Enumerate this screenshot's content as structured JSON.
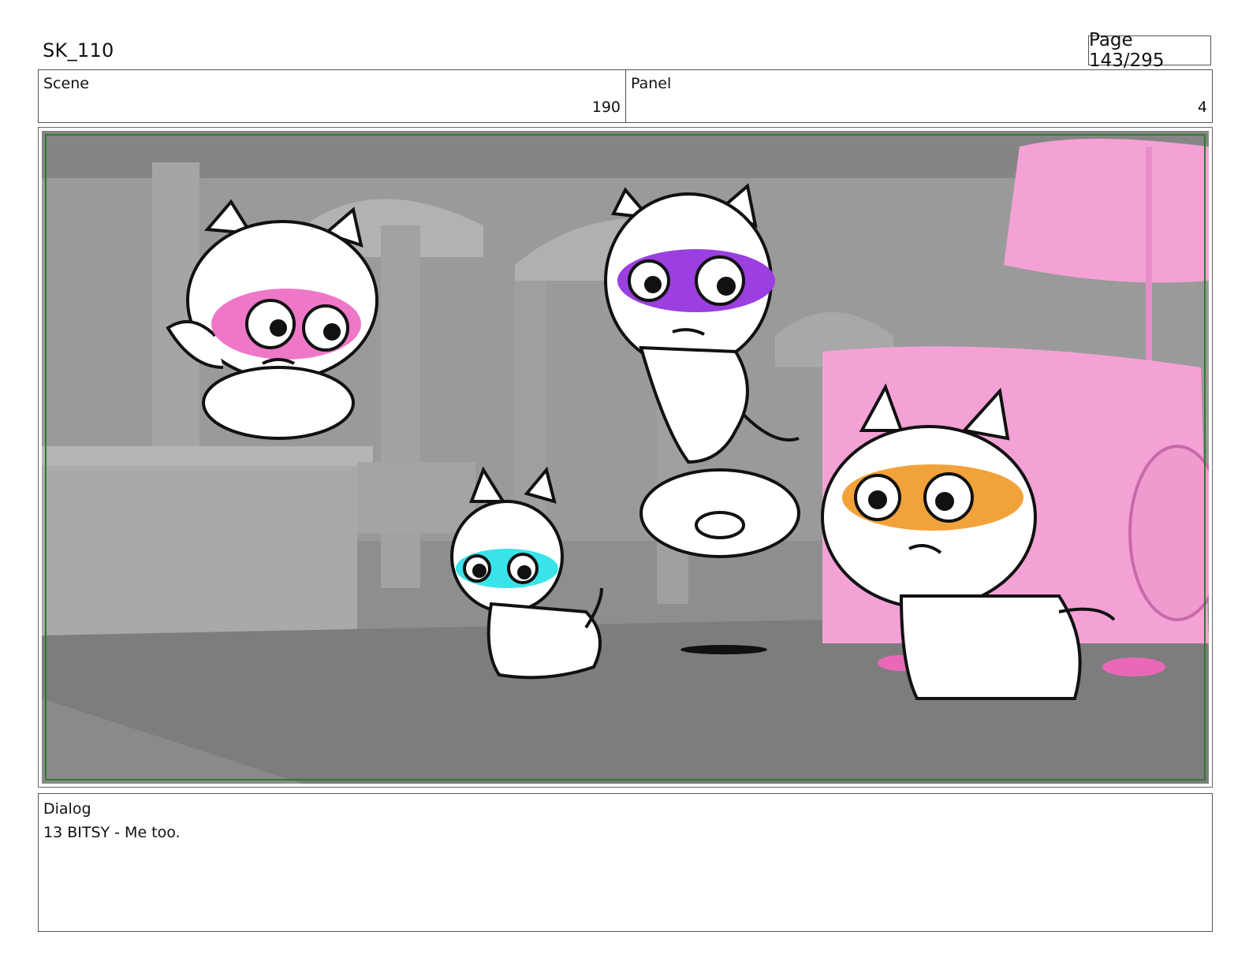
{
  "header": {
    "title": "SK_110",
    "page_label": "Page 143/295"
  },
  "info": {
    "scene_label": "Scene",
    "scene_value": "190",
    "panel_label": "Panel",
    "panel_value": "4"
  },
  "frame": {
    "characters": [
      {
        "id": "cat-pink-mask",
        "mask_color": "#ee77c8"
      },
      {
        "id": "cat-purple-mask",
        "mask_color": "#9b3fe0"
      },
      {
        "id": "cat-cyan-mask",
        "mask_color": "#39e3ea"
      },
      {
        "id": "cat-orange-mask",
        "mask_color": "#f2a23a"
      }
    ],
    "safe_border_color": "#2f7a2f",
    "prop_color": "#f4a2d6"
  },
  "dialog": {
    "label": "Dialog",
    "text": "13 BITSY - Me too."
  }
}
